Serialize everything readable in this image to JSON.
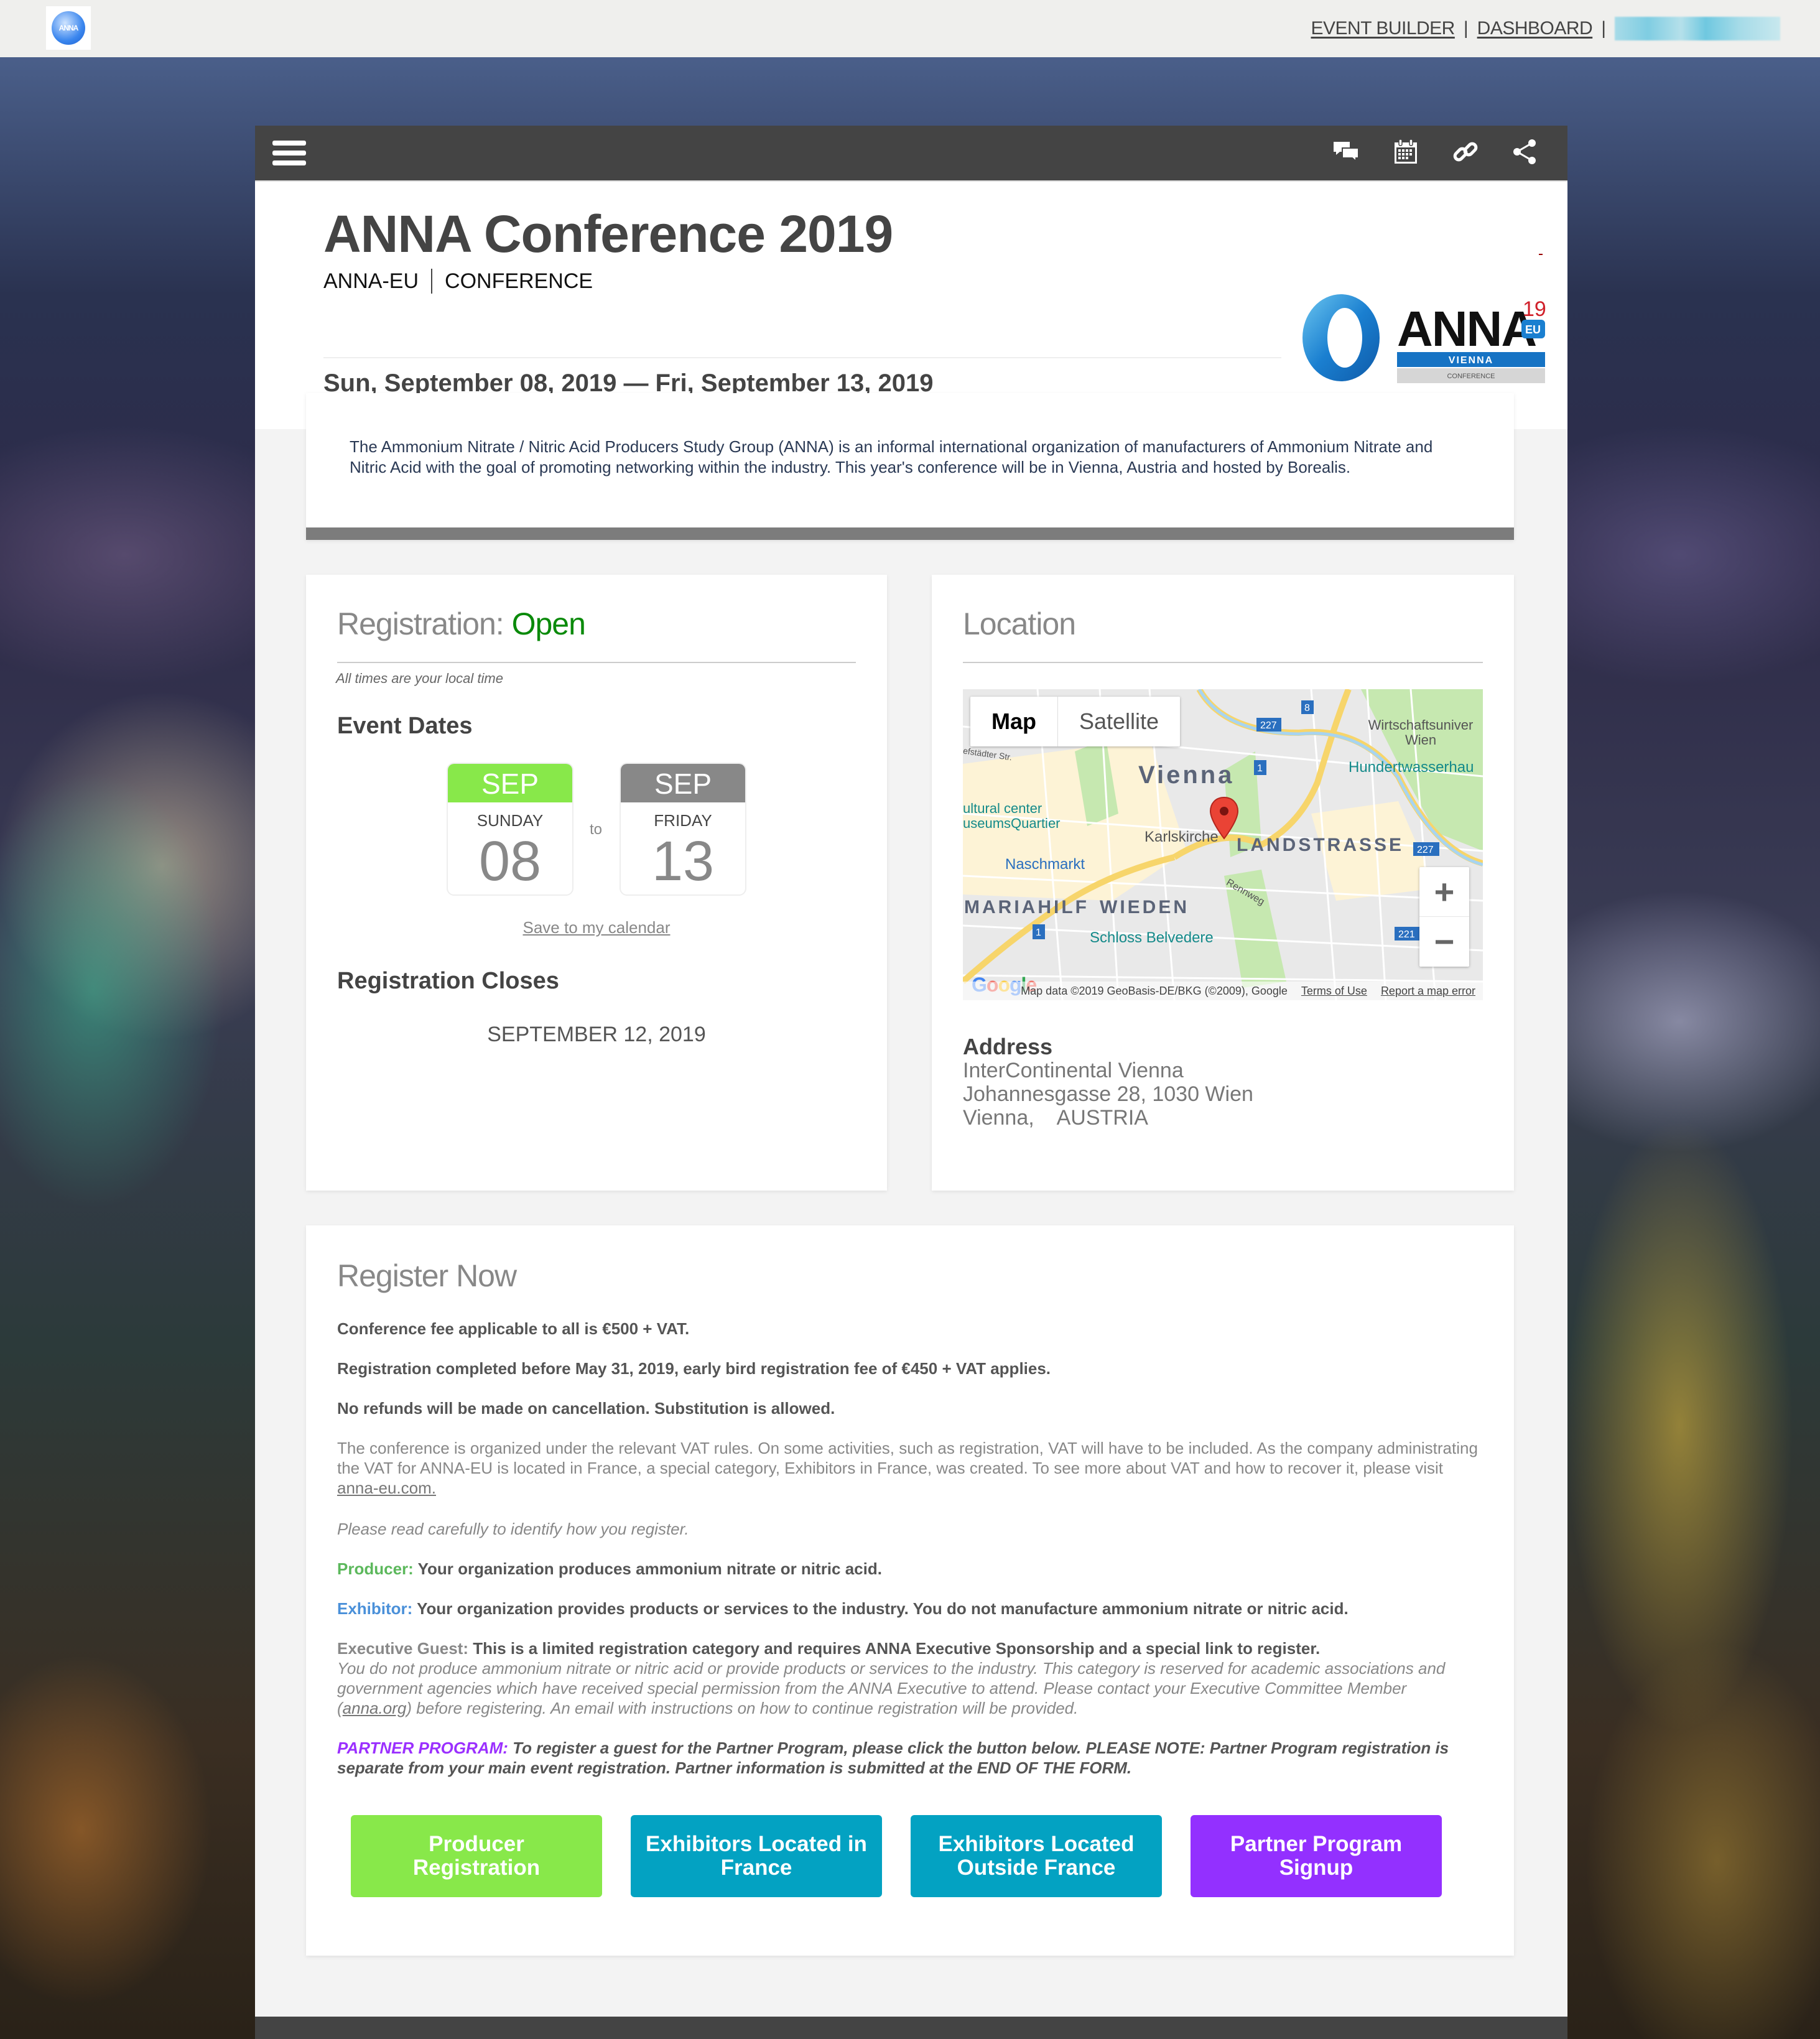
{
  "topbar": {
    "logo_text": "ANNA",
    "nav": [
      {
        "label": "EVENT BUILDER"
      },
      {
        "label": "DASHBOARD"
      }
    ],
    "separator": "|"
  },
  "toolbar": {
    "icons": [
      "chat-icon",
      "calendar-icon",
      "link-icon",
      "share-icon"
    ]
  },
  "header": {
    "title": "ANNA Conference 2019",
    "organizer": "ANNA-EU",
    "event_type": "CONFERENCE",
    "dates": "Sun, September 08, 2019 — Fri, September 13, 2019",
    "logo": {
      "word": "ANNA",
      "year": "19",
      "badge": "EU",
      "city": "VIENNA",
      "tag": "CONFERENCE"
    }
  },
  "description": "The Ammonium Nitrate / Nitric Acid Producers Study Group (ANNA) is an informal international organization of manufacturers of Ammonium Nitrate and Nitric Acid with the goal of promoting networking within the industry. This year's conference will be in Vienna, Austria and hosted by Borealis.",
  "registration": {
    "title_prefix": "Registration:",
    "status": "Open",
    "local_time_note": "All times are your local time",
    "event_dates_heading": "Event Dates",
    "start": {
      "month": "SEP",
      "weekday": "SUNDAY",
      "day": "08"
    },
    "to": "to",
    "end": {
      "month": "SEP",
      "weekday": "FRIDAY",
      "day": "13"
    },
    "save_calendar": "Save to my calendar",
    "closes_heading": "Registration Closes",
    "closes_date": "SEPTEMBER 12, 2019",
    "colors": {
      "start_month": "#88e84a",
      "end_month": "#888888",
      "open": "#0a8a0a"
    }
  },
  "location": {
    "title": "Location",
    "map": {
      "toggle_map": "Map",
      "toggle_satellite": "Satellite",
      "zoom_in": "+",
      "zoom_out": "−",
      "labels": {
        "city": "Vienna",
        "district1": "LANDSTRASSE",
        "district2": "MARIAHILF",
        "district3": "WIEDEN"
      },
      "pois": [
        "Karlskirche",
        "Naschmarkt",
        "Schloss Belvedere",
        "Hundertwasserhau",
        "Wirtschaftsuniver Wien",
        "ultural center useumsQuartier",
        "Rennweg",
        "efstädter Str."
      ],
      "road_shields": [
        "227",
        "8",
        "1",
        "227",
        "1",
        "221"
      ],
      "google": "Google",
      "attribution": "Map data ©2019 GeoBasis-DE/BKG (©2009), Google",
      "terms": "Terms of Use",
      "report": "Report a map error"
    },
    "address_heading": "Address",
    "address_lines": [
      "InterContinental Vienna",
      "Johannesgasse 28, 1030 Wien",
      "Vienna,    AUSTRIA"
    ]
  },
  "register_now": {
    "title": "Register Now",
    "fee": "Conference fee applicable to all is €500 + VAT.",
    "early_bird": "Registration completed before May 31, 2019, early bird registration fee of €450 + VAT applies.",
    "refunds": "No refunds will be made on cancellation. Substitution is allowed.",
    "vat_text": "The conference is organized under the relevant VAT rules. On some activities, such as registration, VAT will have to be included. As the company administrating the VAT for ANNA-EU is located in France, a special category, Exhibitors in France, was created. To see more about VAT and how to recover it, please visit ",
    "vat_link": "anna-eu.com.",
    "read_carefully": "Please read carefully to identify how you register.",
    "producer_label": "Producer:",
    "producer_text": " Your organization produces ammonium nitrate or nitric acid.",
    "exhibitor_label": "Exhibitor:",
    "exhibitor_text": " Your organization provides products or services to the industry. You do not manufacture ammonium nitrate or nitric acid.",
    "exec_label": "Executive Guest:",
    "exec_text": " This is a limited registration category and requires ANNA Executive Sponsorship and a special link to register.",
    "exec_note": "You do not produce ammonium nitrate or nitric acid or provide products or services to the industry. This category is reserved for academic associations and government agencies which have received special permission from the ANNA Executive to attend. Please contact your Executive Committee Member (",
    "exec_link": "anna.org",
    "exec_note_end": ") before registering. An email with instructions on how to continue registration will be provided.",
    "partner_label": "PARTNER PROGRAM:",
    "partner_text": " To register a guest for the Partner Program, please click the button below. PLEASE NOTE: Partner Program registration is separate from your main event registration. Partner information is submitted at the END OF THE FORM.",
    "buttons": [
      {
        "label": "Producer Registration",
        "color": "#88e84a"
      },
      {
        "label": "Exhibitors Located in France",
        "color": "#03a2c2"
      },
      {
        "label": "Exhibitors Located Outside France",
        "color": "#03a2c2"
      },
      {
        "label": "Partner Program Signup",
        "color": "#9330ff"
      }
    ]
  }
}
